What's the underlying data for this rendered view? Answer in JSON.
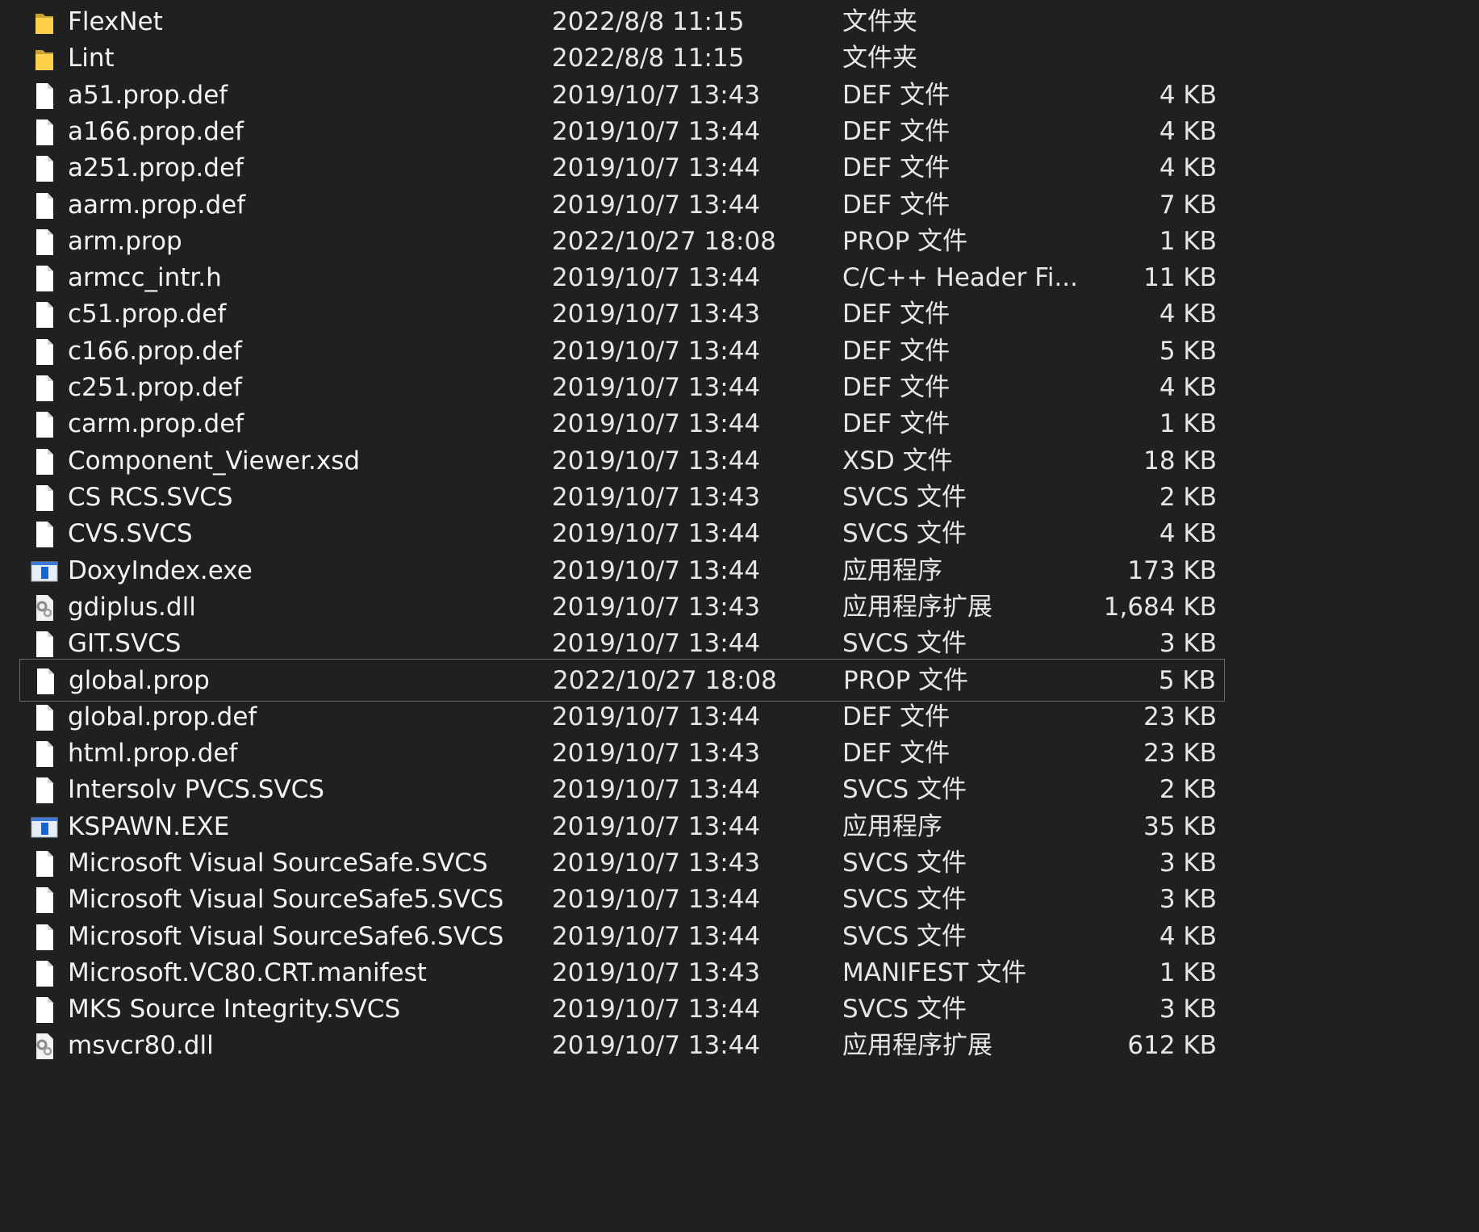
{
  "files": [
    {
      "name": "FlexNet",
      "date": "2022/8/8 11:15",
      "type": "文件夹",
      "size": "",
      "icon": "folder-icon"
    },
    {
      "name": "Lint",
      "date": "2022/8/8 11:15",
      "type": "文件夹",
      "size": "",
      "icon": "folder-icon"
    },
    {
      "name": "a51.prop.def",
      "date": "2019/10/7 13:43",
      "type": "DEF 文件",
      "size": "4 KB",
      "icon": "file-icon"
    },
    {
      "name": "a166.prop.def",
      "date": "2019/10/7 13:44",
      "type": "DEF 文件",
      "size": "4 KB",
      "icon": "file-icon"
    },
    {
      "name": "a251.prop.def",
      "date": "2019/10/7 13:44",
      "type": "DEF 文件",
      "size": "4 KB",
      "icon": "file-icon"
    },
    {
      "name": "aarm.prop.def",
      "date": "2019/10/7 13:44",
      "type": "DEF 文件",
      "size": "7 KB",
      "icon": "file-icon"
    },
    {
      "name": "arm.prop",
      "date": "2022/10/27 18:08",
      "type": "PROP 文件",
      "size": "1 KB",
      "icon": "file-icon"
    },
    {
      "name": "armcc_intr.h",
      "date": "2019/10/7 13:44",
      "type": "C/C++ Header Fi...",
      "size": "11 KB",
      "icon": "file-icon"
    },
    {
      "name": "c51.prop.def",
      "date": "2019/10/7 13:43",
      "type": "DEF 文件",
      "size": "4 KB",
      "icon": "file-icon"
    },
    {
      "name": "c166.prop.def",
      "date": "2019/10/7 13:44",
      "type": "DEF 文件",
      "size": "5 KB",
      "icon": "file-icon"
    },
    {
      "name": "c251.prop.def",
      "date": "2019/10/7 13:44",
      "type": "DEF 文件",
      "size": "4 KB",
      "icon": "file-icon"
    },
    {
      "name": "carm.prop.def",
      "date": "2019/10/7 13:44",
      "type": "DEF 文件",
      "size": "1 KB",
      "icon": "file-icon"
    },
    {
      "name": "Component_Viewer.xsd",
      "date": "2019/10/7 13:44",
      "type": "XSD 文件",
      "size": "18 KB",
      "icon": "file-icon"
    },
    {
      "name": "CS RCS.SVCS",
      "date": "2019/10/7 13:43",
      "type": "SVCS 文件",
      "size": "2 KB",
      "icon": "file-icon"
    },
    {
      "name": "CVS.SVCS",
      "date": "2019/10/7 13:44",
      "type": "SVCS 文件",
      "size": "4 KB",
      "icon": "file-icon"
    },
    {
      "name": "DoxyIndex.exe",
      "date": "2019/10/7 13:44",
      "type": "应用程序",
      "size": "173 KB",
      "icon": "exe-icon"
    },
    {
      "name": "gdiplus.dll",
      "date": "2019/10/7 13:43",
      "type": "应用程序扩展",
      "size": "1,684 KB",
      "icon": "dll-icon"
    },
    {
      "name": "GIT.SVCS",
      "date": "2019/10/7 13:44",
      "type": "SVCS 文件",
      "size": "3 KB",
      "icon": "file-icon"
    },
    {
      "name": "global.prop",
      "date": "2022/10/27 18:08",
      "type": "PROP 文件",
      "size": "5 KB",
      "icon": "file-icon",
      "focused": true
    },
    {
      "name": "global.prop.def",
      "date": "2019/10/7 13:44",
      "type": "DEF 文件",
      "size": "23 KB",
      "icon": "file-icon"
    },
    {
      "name": "html.prop.def",
      "date": "2019/10/7 13:43",
      "type": "DEF 文件",
      "size": "23 KB",
      "icon": "file-icon"
    },
    {
      "name": "Intersolv PVCS.SVCS",
      "date": "2019/10/7 13:44",
      "type": "SVCS 文件",
      "size": "2 KB",
      "icon": "file-icon"
    },
    {
      "name": "KSPAWN.EXE",
      "date": "2019/10/7 13:44",
      "type": "应用程序",
      "size": "35 KB",
      "icon": "exe-icon"
    },
    {
      "name": "Microsoft Visual SourceSafe.SVCS",
      "date": "2019/10/7 13:43",
      "type": "SVCS 文件",
      "size": "3 KB",
      "icon": "file-icon"
    },
    {
      "name": "Microsoft Visual SourceSafe5.SVCS",
      "date": "2019/10/7 13:44",
      "type": "SVCS 文件",
      "size": "3 KB",
      "icon": "file-icon"
    },
    {
      "name": "Microsoft Visual SourceSafe6.SVCS",
      "date": "2019/10/7 13:44",
      "type": "SVCS 文件",
      "size": "4 KB",
      "icon": "file-icon"
    },
    {
      "name": "Microsoft.VC80.CRT.manifest",
      "date": "2019/10/7 13:43",
      "type": "MANIFEST 文件",
      "size": "1 KB",
      "icon": "file-icon"
    },
    {
      "name": "MKS Source Integrity.SVCS",
      "date": "2019/10/7 13:44",
      "type": "SVCS 文件",
      "size": "3 KB",
      "icon": "file-icon"
    },
    {
      "name": "msvcr80.dll",
      "date": "2019/10/7 13:44",
      "type": "应用程序扩展",
      "size": "612 KB",
      "icon": "dll-icon"
    }
  ]
}
